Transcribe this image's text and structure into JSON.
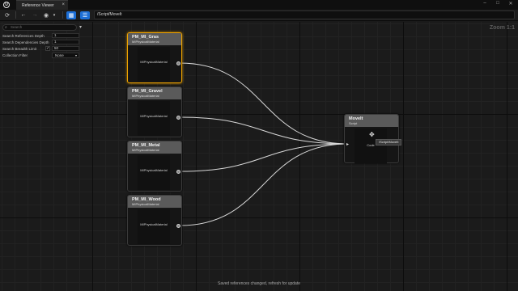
{
  "titlebar": {
    "tab_label": "Reference Viewer",
    "tab_close": "×",
    "win_min": "–",
    "win_max": "□",
    "win_close": "✕",
    "logo": "U"
  },
  "toolbar": {
    "refresh_icon": "⟳",
    "back_icon": "←",
    "forward_icon": "→",
    "history_icon": "◉",
    "history_caret": "▾",
    "graph_icon": "▦",
    "tree_icon": "☰",
    "settings_icon": "≡",
    "path": "/Script/MoveIt"
  },
  "panel": {
    "search_placeholder": "Search",
    "search_icon": "⌕",
    "filter_icon": "▾",
    "options": [
      {
        "label": "Search References Depth",
        "value": "1"
      },
      {
        "label": "Search Dependencies Depth",
        "value": "1"
      },
      {
        "label": "Search Breadth Limit",
        "checked": "✓",
        "value": "50"
      },
      {
        "label": "Collection Filter",
        "value": "None",
        "caret": "▾"
      }
    ]
  },
  "graph": {
    "zoom": "Zoom 1:1",
    "status": "Saved references changed, refresh for update",
    "nodes": [
      {
        "title": "PM_MI_Gras",
        "subtitle": "MIPhysicalMaterial",
        "center": "MIPhysicalMaterial",
        "selected": true
      },
      {
        "title": "PM_MI_Gravel",
        "subtitle": "MIPhysicalMaterial",
        "center": "MIPhysicalMaterial",
        "selected": false
      },
      {
        "title": "PM_MI_Metal",
        "subtitle": "MIPhysicalMaterial",
        "center": "MIPhysicalMaterial",
        "selected": false
      },
      {
        "title": "PM_MI_Wood",
        "subtitle": "MIPhysicalMaterial",
        "center": "MIPhysicalMaterial",
        "selected": false
      }
    ],
    "target": {
      "title": "MoveIt",
      "subtitle": "Script",
      "center": "Code",
      "pin": "▸"
    },
    "tooltip": "/Script/MoveIt",
    "colors": {
      "selected_border": "#f0a400",
      "header": "#5a5a5a",
      "accent": "#1c6ed6"
    }
  }
}
